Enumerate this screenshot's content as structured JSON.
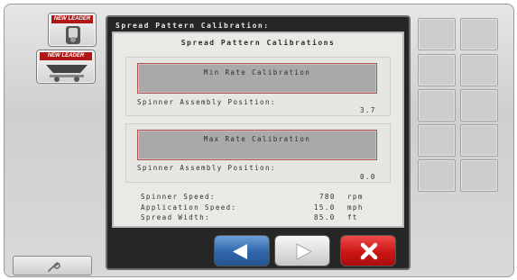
{
  "header": {
    "title": "Spread Pattern Calibration:"
  },
  "nav": {
    "items": [
      {
        "brand": "NEW LEADER",
        "icon": "spinner-control-icon"
      },
      {
        "brand": "NEW LEADER",
        "icon": "spreader-icon"
      }
    ],
    "tools_icon": "wrench-icon"
  },
  "panel": {
    "title": "Spread Pattern Calibrations",
    "min": {
      "button_label": "Min Rate Calibration",
      "position_label": "Spinner Assembly Position:",
      "position_value": "3.7"
    },
    "max": {
      "button_label": "Max Rate Calibration",
      "position_label": "Spinner Assembly Position:",
      "position_value": "0.0"
    },
    "stats": [
      {
        "label": "Spinner Speed:",
        "value": "780",
        "unit": "rpm"
      },
      {
        "label": "Application Speed:",
        "value": "15.0",
        "unit": "mph"
      },
      {
        "label": "Spread Width:",
        "value": "85.0",
        "unit": "ft"
      }
    ]
  },
  "footer": {
    "back_icon": "left-arrow-icon",
    "forward_icon": "right-arrow-icon",
    "cancel_icon": "close-icon"
  },
  "colors": {
    "back": "#2f66aa",
    "cancel": "#cc1515",
    "brand": "#b01818"
  }
}
